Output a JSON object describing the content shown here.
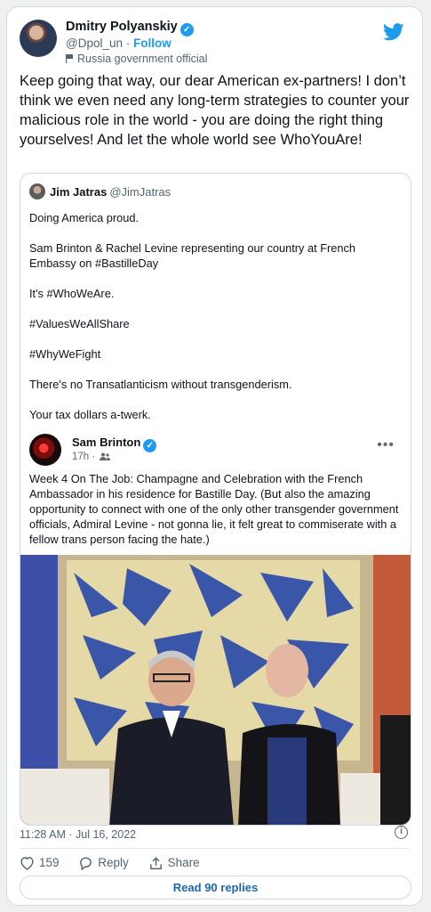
{
  "author": {
    "name": "Dmitry Polyanskiy",
    "handle": "@Dpol_un",
    "separator": "·",
    "follow_label": "Follow",
    "label": "Russia government official",
    "verified_icon": "verified-badge-icon"
  },
  "tweet": {
    "text": "Keep going that way, our dear American ex-partners! I don’t think we even need any long-term strategies to counter your malicious role in the world - you are doing the right thing yourselves! And let the whole world see WhoYouAre!"
  },
  "quote": {
    "name": "Jim Jatras",
    "handle": "@JimJatras",
    "text": "Doing America proud.\n\nSam Brinton & Rachel Levine representing our country at French Embassy on #BastilleDay\n\nIt's #WhoWeAre.\n\n#ValuesWeAllShare\n\n#WhyWeFight\n\nThere's no Transatlanticism without transgenderism.\n\nYour tax dollars a-twerk."
  },
  "fb_post": {
    "name": "Sam Brinton",
    "time": "17h ·",
    "more": "•••",
    "text": "Week 4 On The Job: Champagne and Celebration with the French Ambassador in his residence for Bastille Day. (But also the amazing opportunity to connect with one of the only other transgender government officials, Admiral Levine - not gonna lie, it felt great to commiserate with a fellow trans person facing the hate.)"
  },
  "footer": {
    "timestamp": "11:28 AM · Jul 16, 2022",
    "likes": "159",
    "reply_label": "Reply",
    "share_label": "Share",
    "read_replies": "Read 90 replies"
  },
  "colors": {
    "twitter_blue": "#1d9bf0",
    "muted": "#536471"
  }
}
